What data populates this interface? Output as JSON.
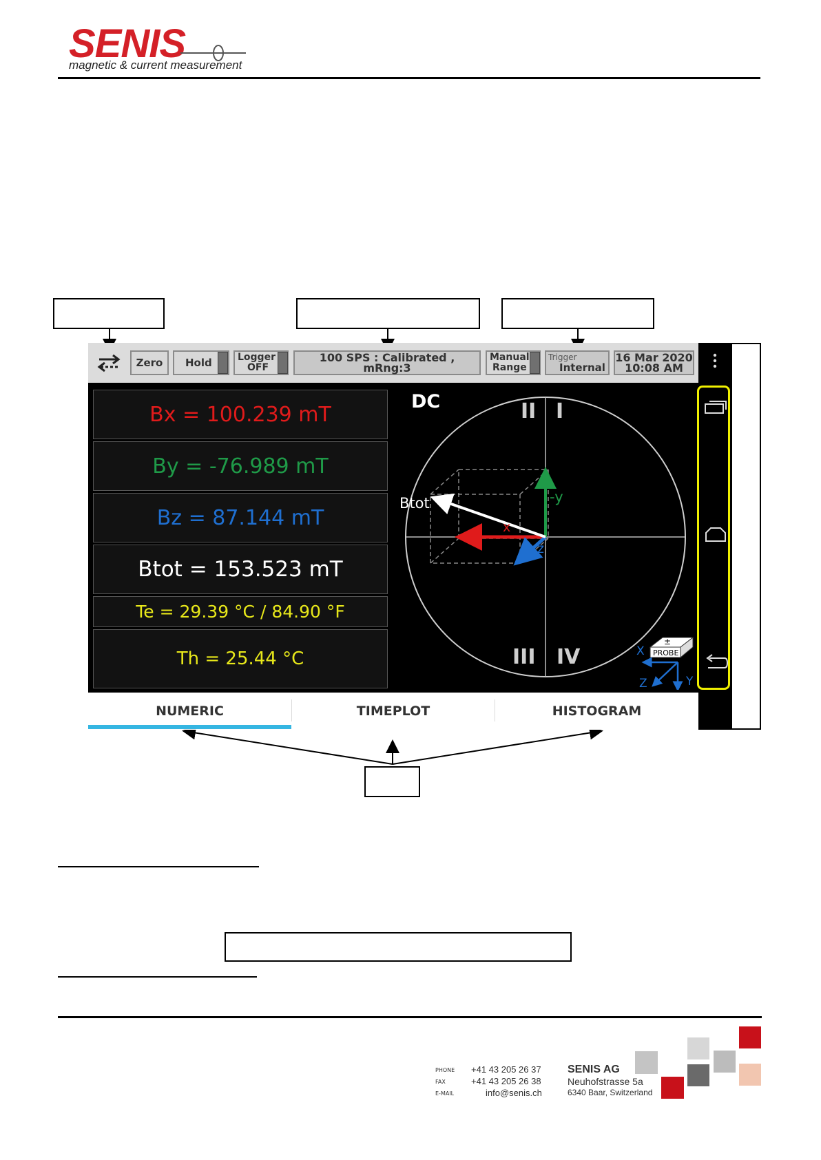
{
  "header": {
    "logo_text": "SENIS",
    "logo_subtitle": "magnetic & current measurement"
  },
  "status_bar": {
    "zero_label": "Zero",
    "hold_label": "Hold",
    "logger_label": "Logger",
    "logger_state": "OFF",
    "mode_text": "100 SPS : Calibrated , mRng:3",
    "manual_line1": "Manual",
    "manual_line2": "Range",
    "trigger_label": "Trigger",
    "trigger_value": "Internal",
    "date": "16 Mar 2020",
    "time": "10:08 AM"
  },
  "readings": {
    "bx": "Bx = 100.239 mT",
    "by": "By = -76.989 mT",
    "bz": "Bz = 87.144 mT",
    "btot": "Btot = 153.523 mT",
    "te": "Te = 29.39 °C / 84.90 °F",
    "th": "Th = 25.44 °C"
  },
  "vector_plot": {
    "mode": "DC",
    "quadrants": [
      "II",
      "I",
      "III",
      "IV"
    ],
    "btot_label": "Btot",
    "x_label": "x",
    "y_label": "-y",
    "z_label": "z",
    "probe_label": "PROBE",
    "probe_sign": "±",
    "axis_x": "X",
    "axis_y": "Y",
    "axis_z": "Z"
  },
  "tabs": [
    {
      "label": "NUMERIC",
      "active": true
    },
    {
      "label": "TIMEPLOT",
      "active": false
    },
    {
      "label": "HISTOGRAM",
      "active": false
    }
  ],
  "footer": {
    "phone_label": "PHONE",
    "phone": "+41 43 205 26 37",
    "fax_label": "FAX",
    "fax": "+41 43 205 26 38",
    "email_label": "E-MAIL",
    "email": "info@senis.ch",
    "company": "SENIS AG",
    "street": "Neuhofstrasse 5a",
    "city": "6340 Baar, Switzerland"
  },
  "colors": {
    "bx": "#e01b1b",
    "by": "#1f9a48",
    "bz": "#1f6fd0",
    "temp": "#e8e81a",
    "tab_accent": "#35b6e2",
    "nav_highlight": "#f0f000",
    "brand_red": "#d42027"
  }
}
